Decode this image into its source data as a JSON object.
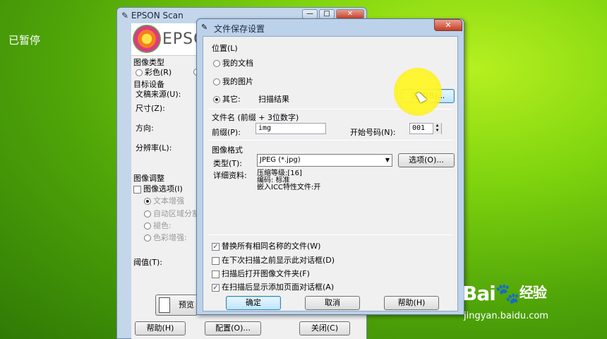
{
  "overlay": {
    "paused_label": "已暂停"
  },
  "back_window": {
    "title": "EPSON Scan",
    "logo_text": "EPSON",
    "minimize": "—",
    "maximize": "□",
    "close": "✕",
    "image_type": {
      "label": "图像类型",
      "color_option": "彩色(R)"
    },
    "target_device": {
      "label": "目标设备",
      "doc_source": "文稿来源(U):",
      "size": "尺寸(Z):",
      "direction": "方向:",
      "resolution": "分辨率(L):"
    },
    "image_adjust": {
      "label": "图像调整",
      "image_options": "图像选项(I)",
      "text_enhance": "文本增强",
      "auto_area": "自动区域分割",
      "fade": "褪色:",
      "color_enhance": "色彩增强:",
      "threshold": "阈值(T):"
    },
    "preview_label": "预览",
    "buttons": {
      "help": "帮助(H)",
      "config": "配置(O)...",
      "close": "关闭(C)"
    }
  },
  "dialog": {
    "title": "文件保存设置",
    "close": "✕",
    "location": {
      "label": "位置(L)",
      "my_documents": "我的文档",
      "my_pictures": "我的图片",
      "other": "其它:",
      "other_value": "扫描结果",
      "browse": "浏览(B)..."
    },
    "filename": {
      "label": "文件名 (前缀 + 3位数字)",
      "prefix_label": "前缀(P):",
      "prefix_value": "img",
      "start_label": "开始号码(N):",
      "start_value": "001"
    },
    "image_format": {
      "label": "图像格式",
      "type_label": "类型(T):",
      "type_value": "JPEG (*.jpg)",
      "options": "选项(O)...",
      "details_label": "详细资料:",
      "detail_lines": [
        "压缩等级:[16]",
        "编码: 标准",
        "嵌入ICC特性文件:开"
      ]
    },
    "checkboxes": [
      {
        "label": "替换所有相同名称的文件(W)",
        "checked": true
      },
      {
        "label": "在下次扫描之前显示此对话框(D)",
        "checked": false
      },
      {
        "label": "扫描后打开图像文件夹(F)",
        "checked": false
      },
      {
        "label": "在扫描后显示添加页面对话框(A)",
        "checked": true
      }
    ],
    "buttons": {
      "ok": "确定",
      "cancel": "取消",
      "help": "帮助(H)"
    }
  },
  "watermark": {
    "brand": "Bai",
    "brand2": "经验",
    "url": "jingyan.baidu.com"
  }
}
